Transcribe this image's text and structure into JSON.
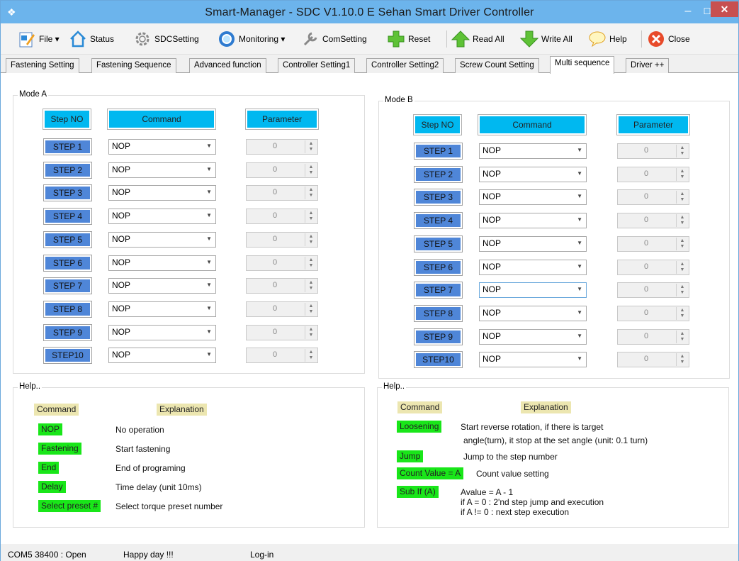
{
  "window": {
    "title": "Smart-Manager - SDC  V1.10.0 E  Sehan Smart Driver Controller"
  },
  "toolbar": {
    "file": "File ▾",
    "status": "Status",
    "sdcsetting": "SDCSetting",
    "monitoring": "Monitoring ▾",
    "comsetting": "ComSetting",
    "reset": "Reset",
    "readall": "Read All",
    "writeall": "Write All",
    "help": "Help",
    "close": "Close"
  },
  "tabs": [
    "Fastening Setting",
    "Fastening Sequence",
    "Advanced function",
    "Controller Setting1",
    "Controller Setting2",
    "Screw Count Setting",
    "Multi sequence",
    "Driver ++"
  ],
  "headers": {
    "step_no": "Step NO",
    "command": "Command",
    "parameter": "Parameter"
  },
  "mode_a": {
    "title": "Mode A",
    "steps": [
      "STEP 1",
      "STEP 2",
      "STEP 3",
      "STEP 4",
      "STEP 5",
      "STEP 6",
      "STEP 7",
      "STEP 8",
      "STEP 9",
      "STEP10"
    ],
    "commands": [
      "NOP",
      "NOP",
      "NOP",
      "NOP",
      "NOP",
      "NOP",
      "NOP",
      "NOP",
      "NOP",
      "NOP"
    ],
    "params": [
      "0",
      "0",
      "0",
      "0",
      "0",
      "0",
      "0",
      "0",
      "0",
      "0"
    ]
  },
  "mode_b": {
    "title": "Mode B",
    "steps": [
      "STEP 1",
      "STEP 2",
      "STEP 3",
      "STEP 4",
      "STEP 5",
      "STEP 6",
      "STEP 7",
      "STEP 8",
      "STEP 9",
      "STEP10"
    ],
    "commands": [
      "NOP",
      "NOP",
      "NOP",
      "NOP",
      "NOP",
      "NOP",
      "NOP",
      "NOP",
      "NOP",
      "NOP"
    ],
    "params": [
      "0",
      "0",
      "0",
      "0",
      "0",
      "0",
      "0",
      "0",
      "0",
      "0"
    ]
  },
  "help_a": {
    "title": "Help..",
    "command_label": "Command",
    "explanation_label": "Explanation",
    "items": [
      {
        "cmd": "NOP",
        "desc": "No operation"
      },
      {
        "cmd": "Fastening",
        "desc": "Start fastening"
      },
      {
        "cmd": "End",
        "desc": "End of programing"
      },
      {
        "cmd": "Delay",
        "desc": "Time delay (unit 10ms)"
      },
      {
        "cmd": "Select preset #",
        "desc": "Select torque preset number"
      }
    ]
  },
  "help_b": {
    "title": "Help..",
    "command_label": "Command",
    "explanation_label": "Explanation",
    "items": [
      {
        "cmd": "Loosening",
        "desc": "Start reverse rotation, if there is target",
        "desc2": "angle(turn), it stop at the set angle (unit: 0.1 turn)"
      },
      {
        "cmd": "Jump",
        "desc": "Jump to the step number"
      },
      {
        "cmd": "Count Value = A",
        "desc": "Count value setting"
      },
      {
        "cmd": "Sub If (A)",
        "desc": "Avalue = A - 1",
        "desc2": "if A = 0 : 2'nd step jump and execution",
        "desc3": "if A != 0 : next step execution"
      }
    ]
  },
  "status": {
    "port": "COM5  38400 : Open",
    "message": "Happy day !!!",
    "login": "Log-in"
  },
  "colors": {
    "title_bar": "#6cb4ec",
    "header_cyan": "#00b8f0",
    "step_blue": "#4f86d8",
    "help_green": "#19e619",
    "help_yellow": "#ece6b0",
    "close_red": "#c75050"
  }
}
